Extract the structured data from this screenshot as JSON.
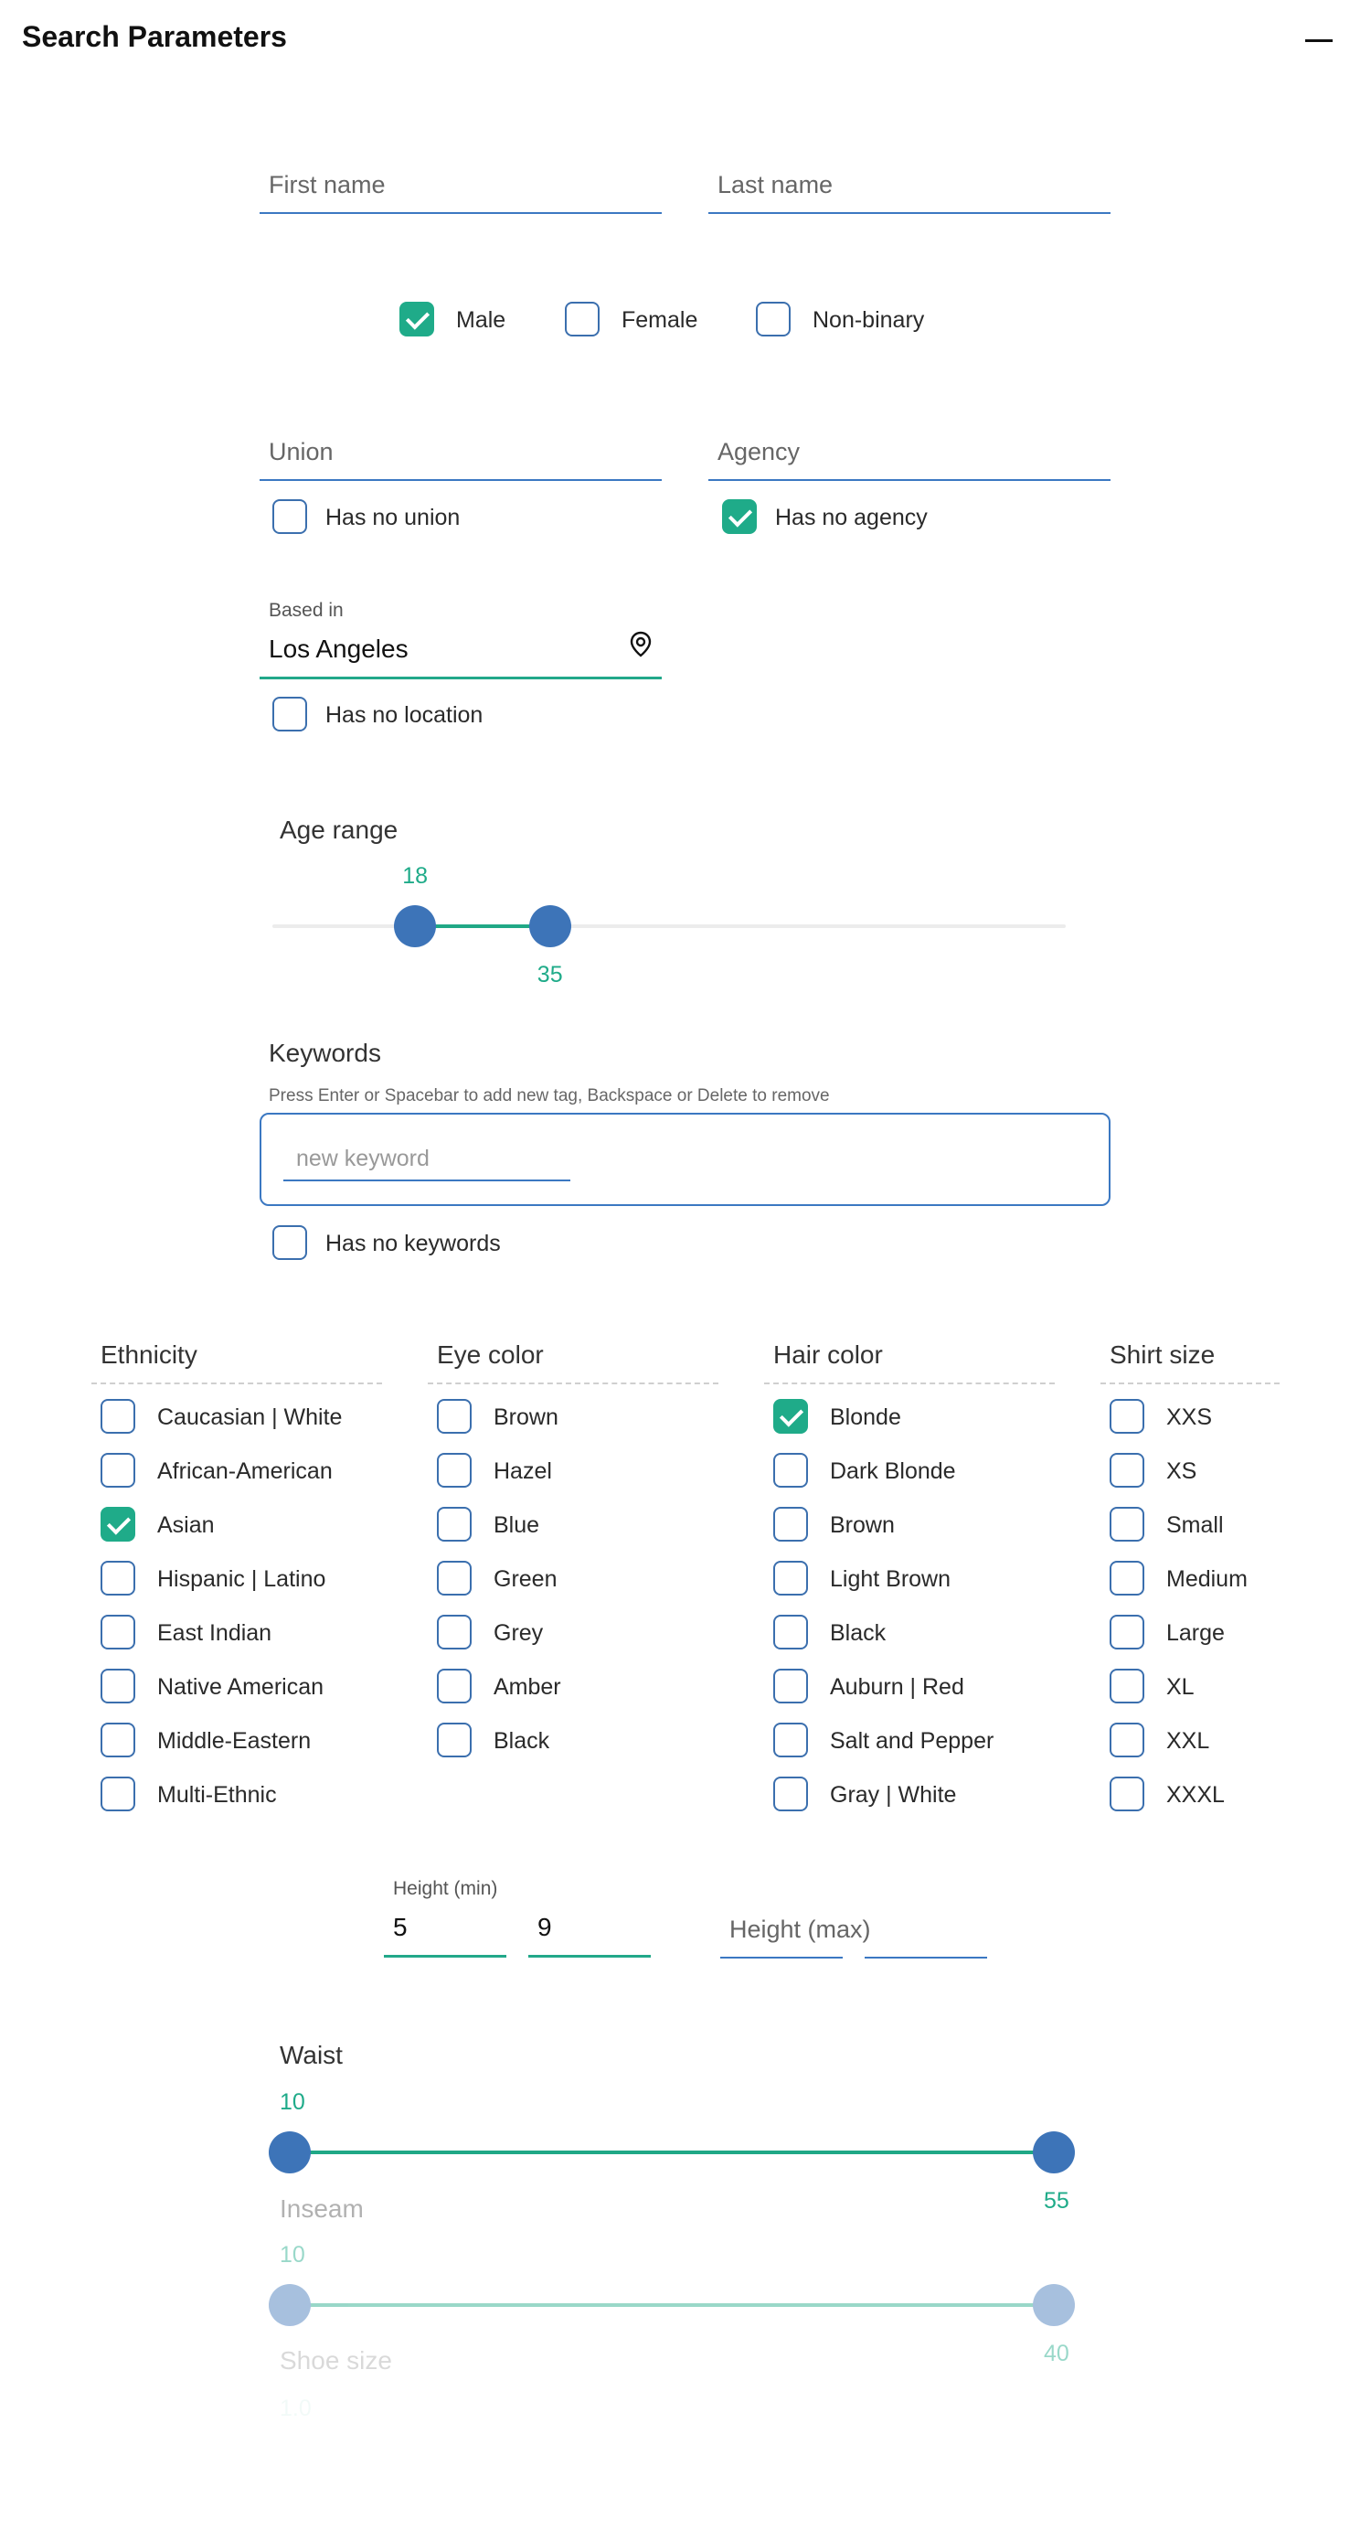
{
  "panel": {
    "title": "Search Parameters"
  },
  "name": {
    "first_placeholder": "First name",
    "last_placeholder": "Last name"
  },
  "gender": [
    {
      "label": "Male",
      "checked": true
    },
    {
      "label": "Female",
      "checked": false
    },
    {
      "label": "Non-binary",
      "checked": false
    }
  ],
  "union": {
    "placeholder": "Union",
    "none_label": "Has no union",
    "none_checked": false
  },
  "agency": {
    "placeholder": "Agency",
    "none_label": "Has no agency",
    "none_checked": true
  },
  "location": {
    "label": "Based in",
    "value": "Los Angeles",
    "none_label": "Has no location",
    "none_checked": false,
    "icon": "location-pin-icon"
  },
  "age_range": {
    "label": "Age range",
    "min": 18,
    "max": 35
  },
  "keywords": {
    "label": "Keywords",
    "help": "Press Enter or Spacebar to add new tag, Backspace or Delete to remove",
    "placeholder": "new keyword",
    "none_label": "Has no keywords",
    "none_checked": false
  },
  "ethnicity": {
    "label": "Ethnicity",
    "options": [
      {
        "label": "Caucasian | White",
        "checked": false
      },
      {
        "label": "African-American",
        "checked": false
      },
      {
        "label": "Asian",
        "checked": true
      },
      {
        "label": "Hispanic | Latino",
        "checked": false
      },
      {
        "label": "East Indian",
        "checked": false
      },
      {
        "label": "Native American",
        "checked": false
      },
      {
        "label": "Middle-Eastern",
        "checked": false
      },
      {
        "label": "Multi-Ethnic",
        "checked": false
      }
    ]
  },
  "eye_color": {
    "label": "Eye color",
    "options": [
      {
        "label": "Brown",
        "checked": false
      },
      {
        "label": "Hazel",
        "checked": false
      },
      {
        "label": "Blue",
        "checked": false
      },
      {
        "label": "Green",
        "checked": false
      },
      {
        "label": "Grey",
        "checked": false
      },
      {
        "label": "Amber",
        "checked": false
      },
      {
        "label": "Black",
        "checked": false
      }
    ]
  },
  "hair_color": {
    "label": "Hair color",
    "options": [
      {
        "label": "Blonde",
        "checked": true
      },
      {
        "label": "Dark Blonde",
        "checked": false
      },
      {
        "label": "Brown",
        "checked": false
      },
      {
        "label": "Light Brown",
        "checked": false
      },
      {
        "label": "Black",
        "checked": false
      },
      {
        "label": "Auburn | Red",
        "checked": false
      },
      {
        "label": "Salt and Pepper",
        "checked": false
      },
      {
        "label": "Gray | White",
        "checked": false
      }
    ]
  },
  "shirt_size": {
    "label": "Shirt size",
    "options": [
      {
        "label": "XXS",
        "checked": false
      },
      {
        "label": "XS",
        "checked": false
      },
      {
        "label": "Small",
        "checked": false
      },
      {
        "label": "Medium",
        "checked": false
      },
      {
        "label": "Large",
        "checked": false
      },
      {
        "label": "XL",
        "checked": false
      },
      {
        "label": "XXL",
        "checked": false
      },
      {
        "label": "XXXL",
        "checked": false
      }
    ]
  },
  "height": {
    "min_label": "Height (min)",
    "min_feet": "5",
    "min_inches": "9",
    "max_placeholder": "Height (max)"
  },
  "waist": {
    "label": "Waist",
    "min": 10,
    "max": 55
  },
  "inseam": {
    "label": "Inseam",
    "min": 10,
    "max": 40
  },
  "shoe_size": {
    "label": "Shoe size",
    "min": "1.0"
  },
  "colors": {
    "accent": "#1fab89",
    "primary": "#3b78c2",
    "handle": "#3d74b8"
  }
}
